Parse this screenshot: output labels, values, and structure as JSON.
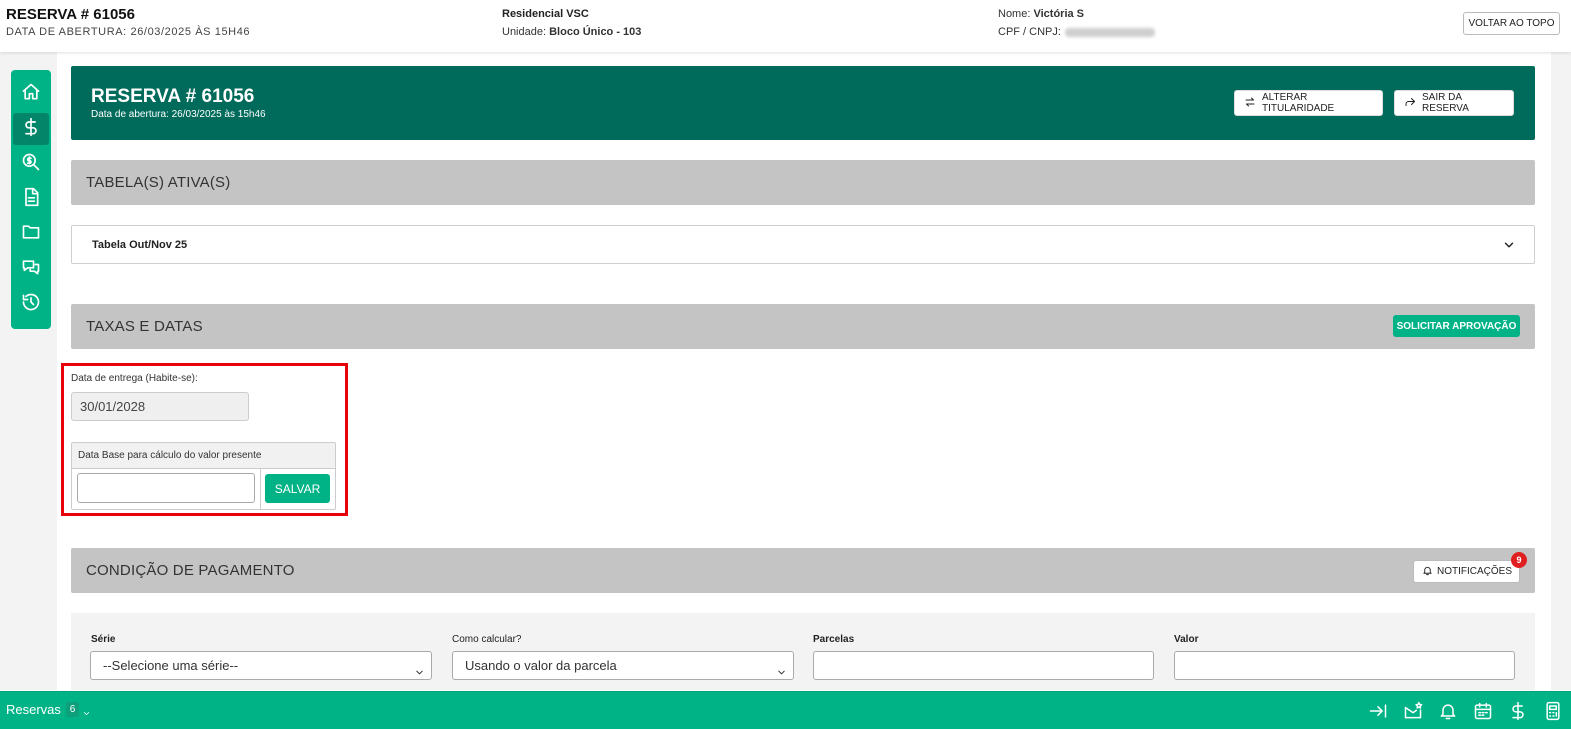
{
  "header": {
    "reservation_title": "RESERVA # 61056",
    "opening_date": "DATA DE ABERTURA: 26/03/2025 ÀS 15H46",
    "project_name": "Residencial VSC",
    "unit_label": "Unidade:",
    "unit_value": "Bloco Único - 103",
    "client_label": "Nome:",
    "client_value": "Victória S",
    "cpf_label": "CPF / CNPJ:",
    "back_to_top": "VOLTAR AO TOPO"
  },
  "sidebar": {
    "items": [
      {
        "icon": "home-icon",
        "active": false
      },
      {
        "icon": "dollar-icon",
        "active": true
      },
      {
        "icon": "search-dollar-icon",
        "active": false
      },
      {
        "icon": "document-icon",
        "active": false
      },
      {
        "icon": "folder-icon",
        "active": false
      },
      {
        "icon": "chat-icon",
        "active": false
      },
      {
        "icon": "history-icon",
        "active": false
      }
    ]
  },
  "banner": {
    "title": "RESERVA # 61056",
    "subtitle": "Data de abertura: 26/03/2025 às 15h46",
    "change_ownership": "ALTERAR TITULARIDADE",
    "exit_reservation": "SAIR DA RESERVA"
  },
  "active_tables": {
    "title": "TABELA(S) ATIVA(S)",
    "selected": "Tabela Out/Nov 25"
  },
  "fees_dates": {
    "title": "TAXAS E DATAS",
    "request_approval": "SOLICITAR APROVAÇÃO",
    "delivery_label": "Data de entrega (Habite-se):",
    "delivery_value": "30/01/2028",
    "base_date_label": "Data Base para cálculo do valor presente",
    "base_date_value": "",
    "save": "SALVAR"
  },
  "payment": {
    "title": "CONDIÇÃO DE PAGAMENTO",
    "notifications": "NOTIFICAÇÕES",
    "notifications_count": "9",
    "series_label": "Série",
    "series_value": "--Selecione uma série--",
    "calc_label": "Como calcular?",
    "calc_value": "Usando o valor da parcela",
    "installments_label": "Parcelas",
    "installments_value": "",
    "value_label": "Valor",
    "value_value": ""
  },
  "bottombar": {
    "title": "Reservas",
    "count": "6"
  },
  "colors": {
    "brand_green": "#00b386",
    "banner_dark_green": "#006b5b",
    "section_gray": "#c4c4c4",
    "highlight_red": "#e8000b",
    "badge_red": "#e02020"
  }
}
